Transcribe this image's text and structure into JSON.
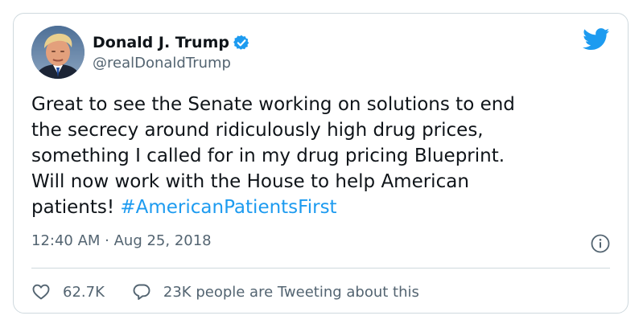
{
  "author": {
    "display_name": "Donald J. Trump",
    "handle": "@realDonaldTrump",
    "avatar_icon": "profile-photo",
    "verified_icon": "verified-badge-icon"
  },
  "brand": {
    "icon": "twitter-bird-icon",
    "accent_color": "#1d9bf0"
  },
  "tweet": {
    "lines": [
      "Great to see the Senate working on solutions to end",
      "the secrecy around ridiculously high drug prices,",
      "something I called for in my drug pricing Blueprint.",
      "Will now work with the House to help American"
    ],
    "last_line_prefix": "patients! ",
    "hashtag": "#AmericanPatientsFirst"
  },
  "meta": {
    "timestamp": "12:40 AM · Aug 25, 2018",
    "info_icon": "info-icon"
  },
  "actions": {
    "like_count": "62.7K",
    "like_icon": "heart-icon",
    "conversation_label": "23K people are Tweeting about this",
    "conversation_icon": "speech-bubble-icon"
  },
  "colors": {
    "text": "#0f1419",
    "secondary_text": "#536471",
    "border": "#cfd9de"
  }
}
